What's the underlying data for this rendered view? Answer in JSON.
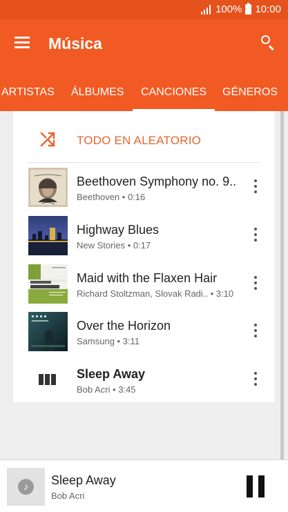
{
  "status_bar": {
    "battery": "100%",
    "time": "10:00"
  },
  "app_bar": {
    "title": "Música"
  },
  "tabs": [
    {
      "label": "ARTISTAS",
      "active": false
    },
    {
      "label": "ÁLBUMES",
      "active": false
    },
    {
      "label": "CANCIONES",
      "active": true
    },
    {
      "label": "GÉNEROS",
      "active": false
    }
  ],
  "shuffle": {
    "label": "TODO EN ALEATORIO",
    "icon": "shuffle-icon",
    "color": "#e5652e"
  },
  "songs": [
    {
      "title": "Beethoven Symphony no. 9..",
      "subtitle": "Beethoven • 0:16",
      "art": "beethoven-portrait"
    },
    {
      "title": "Highway Blues",
      "subtitle": "New Stories • 0:17",
      "art": "album-dusk-skyline"
    },
    {
      "title": "Maid with the Flaxen Hair",
      "subtitle": "Richard Stoltzman, Slovak Radi.. • 3:10",
      "art": "album-richard-stoltzman"
    },
    {
      "title": "Over the Horizon",
      "subtitle": "Samsung • 3:11",
      "art": "album-dark-teal"
    },
    {
      "title": "Sleep Away",
      "subtitle": "Bob Acri • 3:45",
      "art": "now-playing-equalizer-icon",
      "playing": true
    }
  ],
  "now_playing": {
    "title": "Sleep Away",
    "artist": "Bob Acri",
    "art": "music-note-icon"
  },
  "colors": {
    "status_bar": "#e5521c",
    "app_bar": "#f15a22",
    "accent": "#e5652e"
  }
}
